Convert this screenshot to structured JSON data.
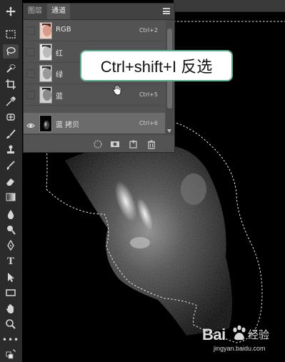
{
  "panel": {
    "tabs": [
      "图层",
      "通道"
    ],
    "active_tab": "通道",
    "channels": [
      {
        "name": "RGB",
        "shortcut": "Ctrl+2",
        "visible": false,
        "selected": false
      },
      {
        "name": "红",
        "shortcut": "",
        "visible": false,
        "selected": false
      },
      {
        "name": "绿",
        "shortcut": "",
        "visible": false,
        "selected": false
      },
      {
        "name": "蓝",
        "shortcut": "Ctrl+5",
        "visible": false,
        "selected": false
      },
      {
        "name": "蓝 拷贝",
        "shortcut": "Ctrl+6",
        "visible": true,
        "selected": true
      }
    ],
    "footer_icons": [
      "load-selection-icon",
      "save-selection-icon",
      "new-channel-icon",
      "delete-channel-icon"
    ]
  },
  "toolbar": {
    "tools": [
      "move-icon",
      "marquee-icon",
      "lasso-icon",
      "quick-selection-icon",
      "crop-icon",
      "eyedropper-icon",
      "healing-brush-icon",
      "brush-icon",
      "clone-stamp-icon",
      "history-brush-icon",
      "eraser-icon",
      "gradient-icon",
      "blur-icon",
      "dodge-icon",
      "pen-icon",
      "type-icon",
      "path-selection-icon",
      "rectangle-icon",
      "hand-icon",
      "zoom-icon",
      "more-tools-icon",
      "swap-colors-icon"
    ],
    "active_tool": "lasso-icon"
  },
  "callout": {
    "text": "Ctrl+shift+I 反选"
  },
  "watermark": {
    "brand": "Bai",
    "brand2": "经验",
    "url": "jingyan.baidu.com"
  },
  "colors": {
    "callout_border": "#5fae8f",
    "panel_bg": "#535353",
    "toolbar_bg": "#2b2b2b"
  }
}
